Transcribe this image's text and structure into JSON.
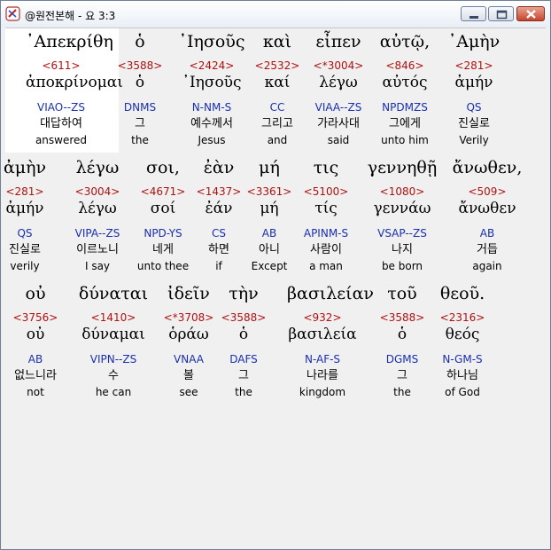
{
  "window": {
    "title": "@원전본해 - 요 3:3",
    "icon": "bible-app-icon"
  },
  "rows": [
    {
      "words": [
        {
          "greek": "᾿Απεκρίθη",
          "strong": "<611>",
          "lexeme": "ἀποκρίνομαι",
          "parsing": "VIAO--ZS",
          "korean": "대답하여",
          "english": "answered"
        },
        {
          "greek": "ὁ",
          "strong": "<3588>",
          "lexeme": "ὁ",
          "parsing": "DNMS",
          "korean": "그",
          "english": "the"
        },
        {
          "greek": "᾿Ιησοῦς",
          "strong": "<2424>",
          "lexeme": "᾿Ιησοῦς",
          "parsing": "N-NM-S",
          "korean": "예수께서",
          "english": "Jesus"
        },
        {
          "greek": "καὶ",
          "strong": "<2532>",
          "lexeme": "καί",
          "parsing": "CC",
          "korean": "그리고",
          "english": "and"
        },
        {
          "greek": "εἶπεν",
          "strong": "<*3004>",
          "lexeme": "λέγω",
          "parsing": "VIAA--ZS",
          "korean": "가라사대",
          "english": "said"
        },
        {
          "greek": "αὐτῷ,",
          "strong": "<846>",
          "lexeme": "αὐτός",
          "parsing": "NPDMZS",
          "korean": "그에게",
          "english": "unto him"
        },
        {
          "greek": "᾿Αμὴν",
          "strong": "<281>",
          "lexeme": "ἀμήν",
          "parsing": "QS",
          "korean": "진실로",
          "english": "Verily"
        }
      ]
    },
    {
      "words": [
        {
          "greek": "ἀμὴν",
          "strong": "<281>",
          "lexeme": "ἀμήν",
          "parsing": "QS",
          "korean": "진실로",
          "english": "verily"
        },
        {
          "greek": "λέγω",
          "strong": "<3004>",
          "lexeme": "λέγω",
          "parsing": "VIPA--ZS",
          "korean": "이르노니",
          "english": "I say"
        },
        {
          "greek": "σοι,",
          "strong": "<4671>",
          "lexeme": "σοί",
          "parsing": "NPD-YS",
          "korean": "네게",
          "english": "unto thee"
        },
        {
          "greek": "ἐὰν",
          "strong": "<1437>",
          "lexeme": "ἐάν",
          "parsing": "CS",
          "korean": "하면",
          "english": "if"
        },
        {
          "greek": "μή",
          "strong": "<3361>",
          "lexeme": "μή",
          "parsing": "AB",
          "korean": "아니",
          "english": "Except"
        },
        {
          "greek": "τις",
          "strong": "<5100>",
          "lexeme": "τίς",
          "parsing": "APINM-S",
          "korean": "사람이",
          "english": "a man"
        },
        {
          "greek": "γεννηθῇ",
          "strong": "<1080>",
          "lexeme": "γεννάω",
          "parsing": "VSAP--ZS",
          "korean": "나지",
          "english": "be born"
        },
        {
          "greek": "ἄνωθεν,",
          "strong": "<509>",
          "lexeme": "ἄνωθεν",
          "parsing": "AB",
          "korean": "거듭",
          "english": "again"
        }
      ]
    },
    {
      "words": [
        {
          "greek": "οὐ",
          "strong": "<3756>",
          "lexeme": "οὐ",
          "parsing": "AB",
          "korean": "없느니라",
          "english": "not"
        },
        {
          "greek": "δύναται",
          "strong": "<1410>",
          "lexeme": "δύναμαι",
          "parsing": "VIPN--ZS",
          "korean": "수",
          "english": "he can"
        },
        {
          "greek": "ἰδεῖν",
          "strong": "<*3708>",
          "lexeme": "ὁράω",
          "parsing": "VNAA",
          "korean": "볼",
          "english": "see"
        },
        {
          "greek": "τὴν",
          "strong": "<3588>",
          "lexeme": "ὁ",
          "parsing": "DAFS",
          "korean": "그",
          "english": "the"
        },
        {
          "greek": "βασιλείαν",
          "strong": "<932>",
          "lexeme": "βασιλεία",
          "parsing": "N-AF-S",
          "korean": "나라를",
          "english": "kingdom"
        },
        {
          "greek": "τοῦ",
          "strong": "<3588>",
          "lexeme": "ὁ",
          "parsing": "DGMS",
          "korean": "그",
          "english": "the"
        },
        {
          "greek": "θεοῦ.",
          "strong": "<2316>",
          "lexeme": "θεός",
          "parsing": "N-GM-S",
          "korean": "하나님",
          "english": "of God"
        }
      ]
    }
  ]
}
